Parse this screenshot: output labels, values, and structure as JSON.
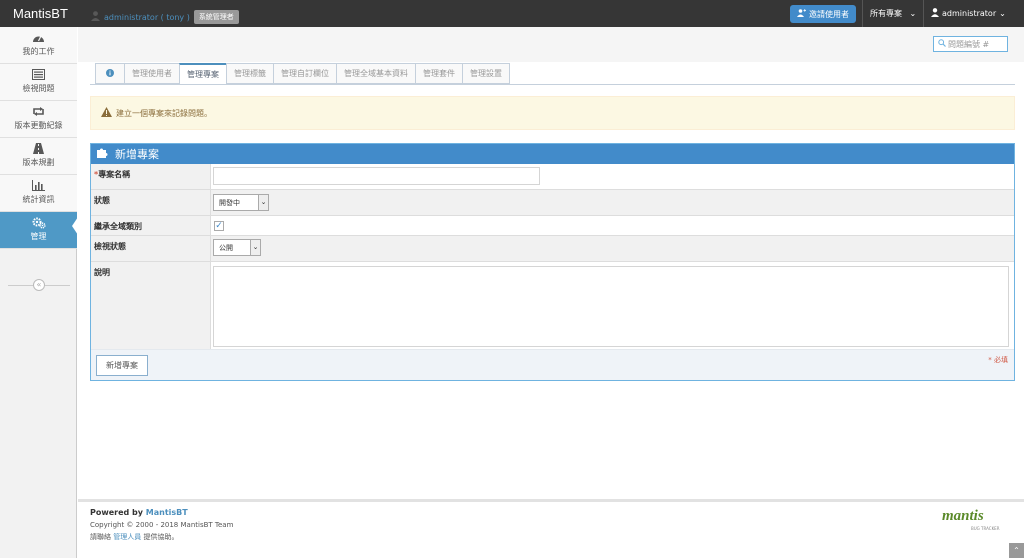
{
  "navbar": {
    "brand": "MantisBT",
    "invite_label": "邀請使用者",
    "project_menu": "所有專案",
    "user_menu": "administrator"
  },
  "sidebar": {
    "items": [
      {
        "label": "我的工作",
        "icon": "tachometer-icon"
      },
      {
        "label": "檢視問題",
        "icon": "list-icon"
      },
      {
        "label": "版本更動紀錄",
        "icon": "retweet-icon"
      },
      {
        "label": "版本規劃",
        "icon": "road-icon"
      },
      {
        "label": "統計資訊",
        "icon": "bar-chart-icon"
      },
      {
        "label": "管理",
        "icon": "gears-icon"
      }
    ]
  },
  "breadcrumb": {
    "user": "administrator ( tony )",
    "role_badge": "系統管理者"
  },
  "search": {
    "placeholder": "問題編號 #"
  },
  "tabs": [
    "管理使用者",
    "管理專案",
    "管理標籤",
    "管理自訂欄位",
    "管理全域基本資料",
    "管理套件",
    "管理設置"
  ],
  "alert": {
    "text": "建立一個專案來記錄問題。"
  },
  "form": {
    "title": "新增專案",
    "name_label": "專案名稱",
    "required_mark": "*",
    "status_label": "狀態",
    "status_value": "開發中",
    "inherit_label": "繼承全域類別",
    "inherit_checked": true,
    "view_status_label": "檢視狀態",
    "view_status_value": "公開",
    "description_label": "說明",
    "submit_label": "新增專案",
    "required_note": "* 必填"
  },
  "footer": {
    "powered_prefix": "Powered by ",
    "powered_link": "MantisBT",
    "copyright": "Copyright © 2000 - 2018 MantisBT Team",
    "contact_prefix": "請聯絡 ",
    "contact_link": "管理人員",
    "contact_suffix": " 提供協助。",
    "logo_text": "mantis",
    "logo_sub": "BUG TRACKER"
  },
  "colors": {
    "accent": "#428bca",
    "navbar": "#363636",
    "sidebar_active": "#4f99c6"
  }
}
